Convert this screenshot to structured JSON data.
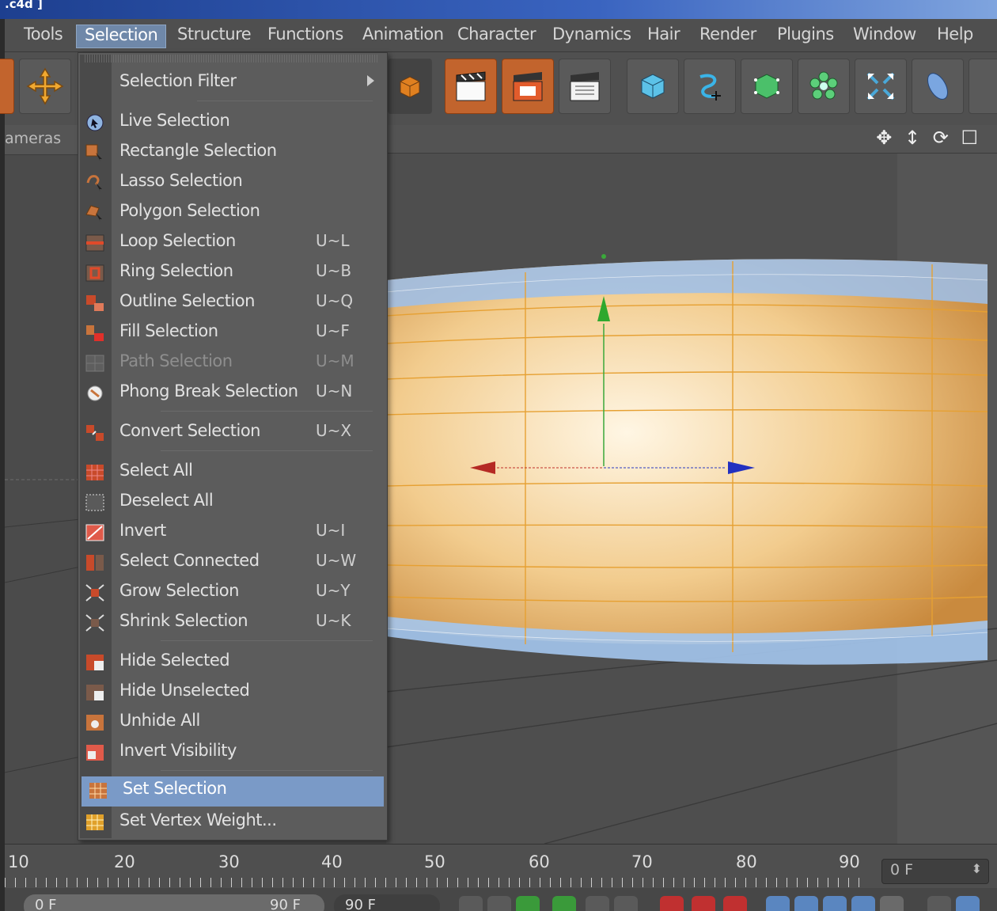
{
  "titlebar": {
    "text": ".c4d ]"
  },
  "menubar": {
    "items": [
      {
        "label": "Tools"
      },
      {
        "label": "Selection"
      },
      {
        "label": "Structure"
      },
      {
        "label": "Functions"
      },
      {
        "label": "Animation"
      },
      {
        "label": "Character"
      },
      {
        "label": "Dynamics"
      },
      {
        "label": "Hair"
      },
      {
        "label": "Render"
      },
      {
        "label": "Plugins"
      },
      {
        "label": "Window"
      },
      {
        "label": "Help"
      }
    ],
    "active": "Selection"
  },
  "left_panel": {
    "tab_label": "ameras"
  },
  "viewport": {
    "nav_icons": "✥ ↕ ⟳ ☐"
  },
  "selection_menu": {
    "items": [
      {
        "label": "Selection Filter",
        "shortcut": "",
        "icon": "filter-icon",
        "submenu": true
      },
      {
        "label": "Live Selection",
        "shortcut": "",
        "icon": "live-selection-icon"
      },
      {
        "label": "Rectangle Selection",
        "shortcut": "",
        "icon": "rectangle-selection-icon"
      },
      {
        "label": "Lasso Selection",
        "shortcut": "",
        "icon": "lasso-selection-icon"
      },
      {
        "label": "Polygon Selection",
        "shortcut": "",
        "icon": "polygon-selection-icon"
      },
      {
        "label": "Loop Selection",
        "shortcut": "U~L",
        "icon": "loop-selection-icon"
      },
      {
        "label": "Ring Selection",
        "shortcut": "U~B",
        "icon": "ring-selection-icon"
      },
      {
        "label": "Outline Selection",
        "shortcut": "U~Q",
        "icon": "outline-selection-icon"
      },
      {
        "label": "Fill Selection",
        "shortcut": "U~F",
        "icon": "fill-selection-icon"
      },
      {
        "label": "Path Selection",
        "shortcut": "U~M",
        "icon": "path-selection-icon",
        "disabled": true
      },
      {
        "label": "Phong Break Selection",
        "shortcut": "U~N",
        "icon": "phong-break-icon"
      },
      {
        "label": "Convert Selection",
        "shortcut": "U~X",
        "icon": "convert-selection-icon"
      },
      {
        "label": "Select All",
        "shortcut": "",
        "icon": "select-all-icon"
      },
      {
        "label": "Deselect All",
        "shortcut": "",
        "icon": "deselect-all-icon"
      },
      {
        "label": "Invert",
        "shortcut": "U~I",
        "icon": "invert-icon"
      },
      {
        "label": "Select Connected",
        "shortcut": "U~W",
        "icon": "select-connected-icon"
      },
      {
        "label": "Grow Selection",
        "shortcut": "U~Y",
        "icon": "grow-selection-icon"
      },
      {
        "label": "Shrink Selection",
        "shortcut": "U~K",
        "icon": "shrink-selection-icon"
      },
      {
        "label": "Hide Selected",
        "shortcut": "",
        "icon": "hide-selected-icon"
      },
      {
        "label": "Hide Unselected",
        "shortcut": "",
        "icon": "hide-unselected-icon"
      },
      {
        "label": "Unhide All",
        "shortcut": "",
        "icon": "unhide-all-icon"
      },
      {
        "label": "Invert Visibility",
        "shortcut": "",
        "icon": "invert-visibility-icon"
      },
      {
        "label": "Set Selection",
        "shortcut": "",
        "icon": "set-selection-icon",
        "highlighted": true
      },
      {
        "label": "Set Vertex Weight...",
        "shortcut": "",
        "icon": "set-vertex-weight-icon"
      }
    ]
  },
  "timeline": {
    "ticks": [
      "10",
      "20",
      "30",
      "40",
      "50",
      "60",
      "70",
      "80",
      "90"
    ],
    "current_frame": "0 F"
  },
  "bottom": {
    "range_start": "0 F",
    "range_end": "90 F",
    "max_frame": "90 F"
  },
  "colors": {
    "accent": "#7a9ac7",
    "selection_orange": "#f0a030",
    "axis_x": "#c0302a",
    "axis_y": "#3aa83a",
    "axis_z": "#2a3ac0"
  }
}
